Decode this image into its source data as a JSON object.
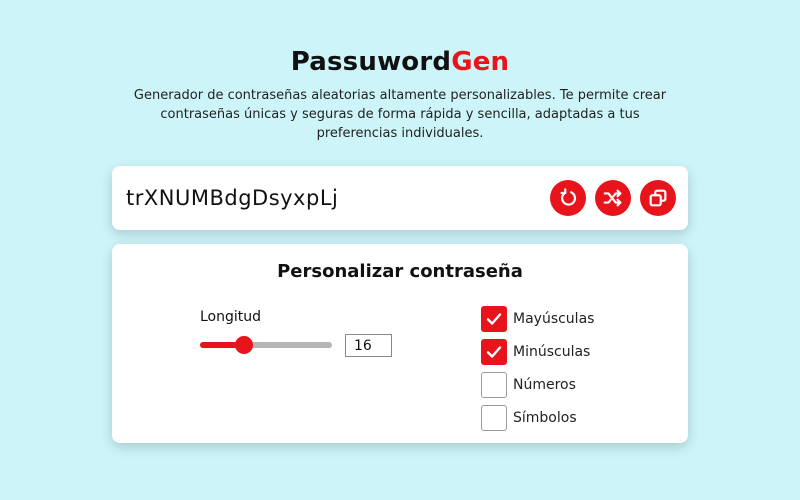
{
  "header": {
    "title_main": "Passuword",
    "title_accent": "Gen",
    "subtitle": "Generador de contraseñas aleatorias altamente personalizables. Te permite crear contraseñas únicas y seguras de forma rápida y sencilla, adaptadas a tus preferencias individuales."
  },
  "password": {
    "value": "trXNUMBdgDsyxpLj",
    "actions": [
      {
        "name": "refresh-icon"
      },
      {
        "name": "shuffle-icon"
      },
      {
        "name": "copy-icon"
      }
    ]
  },
  "customize": {
    "title": "Personalizar contraseña",
    "length_label": "Longitud",
    "length_value": "16",
    "slider_fraction": 0.33,
    "options": [
      {
        "label": "Mayúsculas",
        "checked": true
      },
      {
        "label": "Minúsculas",
        "checked": true
      },
      {
        "label": "Números",
        "checked": false
      },
      {
        "label": "Símbolos",
        "checked": false
      }
    ]
  },
  "colors": {
    "accent": "#e8141b",
    "background": "#cdf5f9",
    "card": "#ffffff"
  }
}
